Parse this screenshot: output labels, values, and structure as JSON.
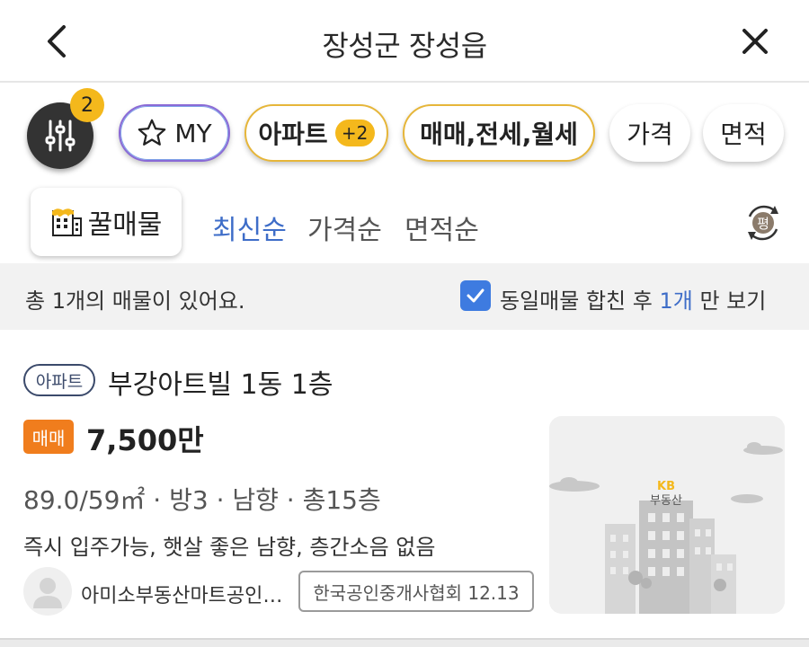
{
  "header": {
    "title": "장성군 장성읍",
    "back_icon": "chevron-left-icon",
    "close_icon": "close-icon"
  },
  "filters": {
    "active_count": "2",
    "my_label": "MY",
    "property_type_label": "아파트",
    "property_type_extra": "+2",
    "deal_type_label": "매매,전세,월세",
    "price_label": "가격",
    "area_label": "면적",
    "colors": {
      "accent": "#f4b81c",
      "my_border": "#8a6ad6"
    }
  },
  "sort": {
    "honey_label": "꿀매물",
    "options": [
      "최신순",
      "가격순",
      "면적순"
    ],
    "selected": "최신순",
    "unit_label": "평",
    "colors": {
      "selected": "#3e6dc8"
    }
  },
  "summary": {
    "count_text": "총 1개의 매물이 있어요.",
    "merge_checked": true,
    "merge_prefix": "동일매물 합친 후 ",
    "merge_count": "1개",
    "merge_suffix": " 만 보기"
  },
  "listing": {
    "type": "아파트",
    "name": "부강아트빌 1동 1층",
    "deal_type": "매매",
    "price": "7,500만",
    "specs": "89.0/59㎡ · 방3 · 남향 · 총15층",
    "description": "즉시 입주가능, 햇살 좋은 남향, 층간소음 없음",
    "agent_name": "아미소부동산마트공인중개사사무소",
    "association": "한국공인중개사협회 12.13",
    "thumbnail_logo_top": "KB",
    "thumbnail_logo_bottom": "부동산",
    "colors": {
      "deal_badge": "#f07d1d",
      "kb": "#f4b81c"
    }
  }
}
